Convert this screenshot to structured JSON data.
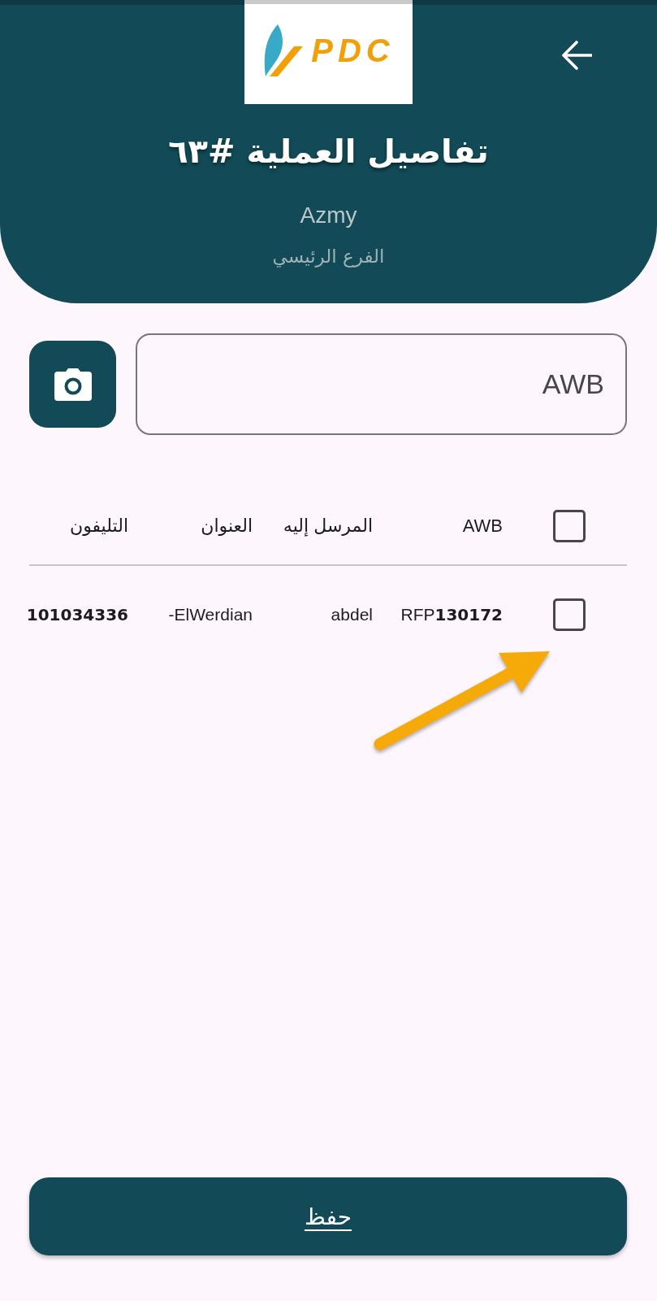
{
  "header": {
    "logo": {
      "text": "PDC"
    },
    "title": "تفاصيل العملية #٦٣",
    "user": "Azmy",
    "branch": "الفرع الرئيسي"
  },
  "scan": {
    "placeholder": "AWB"
  },
  "table": {
    "select_all": {
      "checked": false
    },
    "columns": [
      "AWB",
      "المرسل إليه",
      "العنوان",
      "التليفون"
    ],
    "rows": [
      {
        "checked": false,
        "cells": [
          "RFP**130172**",
          "abdel",
          "-ElWerdian",
          "101034336"
        ]
      }
    ]
  },
  "save_button": {
    "label": "حفظ"
  }
}
